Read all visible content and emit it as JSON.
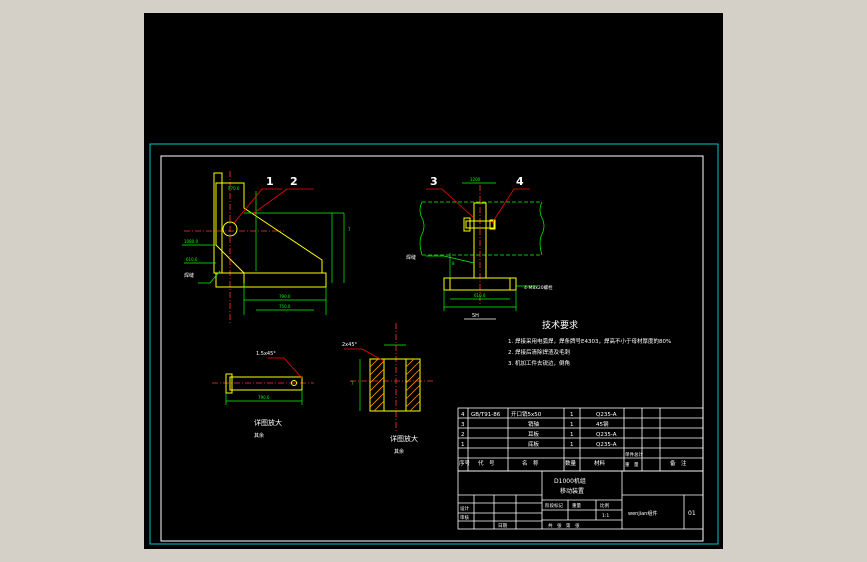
{
  "colors": {
    "app_background": "#d4d0c8",
    "viewport_background": "#000000",
    "frame": "#ffffff",
    "outer_border": "#00c8c8",
    "part_outline": "#ffff00",
    "dimension": "#00ff00",
    "leader": "#ff0000",
    "center_line": "#ff3333",
    "hatch": "#ff9900",
    "text": "#ffffff"
  },
  "balloons": {
    "b1": "1",
    "b2": "2",
    "b3": "3",
    "b4": "4"
  },
  "annotations": {
    "weld_left": "焊缝",
    "weld_right": "焊缝",
    "rod_callout": "4-M8x20螺栓",
    "chamfer_left": "1.5x45°",
    "chamfer_right": "2x45°",
    "dim_a": "970.0",
    "dim_b": "790.0",
    "dim_c": "750.0",
    "dim_d": "610.0",
    "dim_e": "1080.0",
    "dim_f": "7",
    "dim_g": "1200",
    "dim_h": "8",
    "view_label_left": "详图放大",
    "view_scale_left": "其余",
    "view_label_right": "详图放大",
    "view_scale_right": "其余",
    "section_mark": "5H"
  },
  "technical_requirements": {
    "title": "技术要求",
    "items": [
      "1. 焊接采用电弧焊，焊条牌号E4303，焊高不小于母材厚度的80%",
      "2. 焊接后清除焊渣及毛刺",
      "3. 机加工件去锐边，倒角"
    ]
  },
  "bom": {
    "rows": [
      {
        "no": "4",
        "code": "GB/T91-86",
        "name": "开口销5x50",
        "qty": "1",
        "material": "Q235-A"
      },
      {
        "no": "3",
        "code": "",
        "name": "销轴",
        "qty": "1",
        "material": "45钢"
      },
      {
        "no": "2",
        "code": "",
        "name": "耳板",
        "qty": "1",
        "material": "Q235-A"
      },
      {
        "no": "1",
        "code": "",
        "name": "底板",
        "qty": "1",
        "material": "Q235-A"
      }
    ],
    "header": {
      "no": "序号",
      "code": "代　号",
      "name": "名　称",
      "qty": "数量",
      "material": "材料",
      "unit_total": "单件总计",
      "weight": "重　量",
      "note": "备　注"
    }
  },
  "title_block": {
    "drawing_name_line1": "D1000机组",
    "drawing_name_line2": "移动装置",
    "designer": "设计",
    "checker": "审核",
    "date": "日期",
    "stage_mark": "阶段标记",
    "weight": "重量",
    "scale": "比例",
    "scale_value": "1:1",
    "sheet": "共　张　第　张",
    "company": "wenjian组件",
    "code_box": "01"
  }
}
